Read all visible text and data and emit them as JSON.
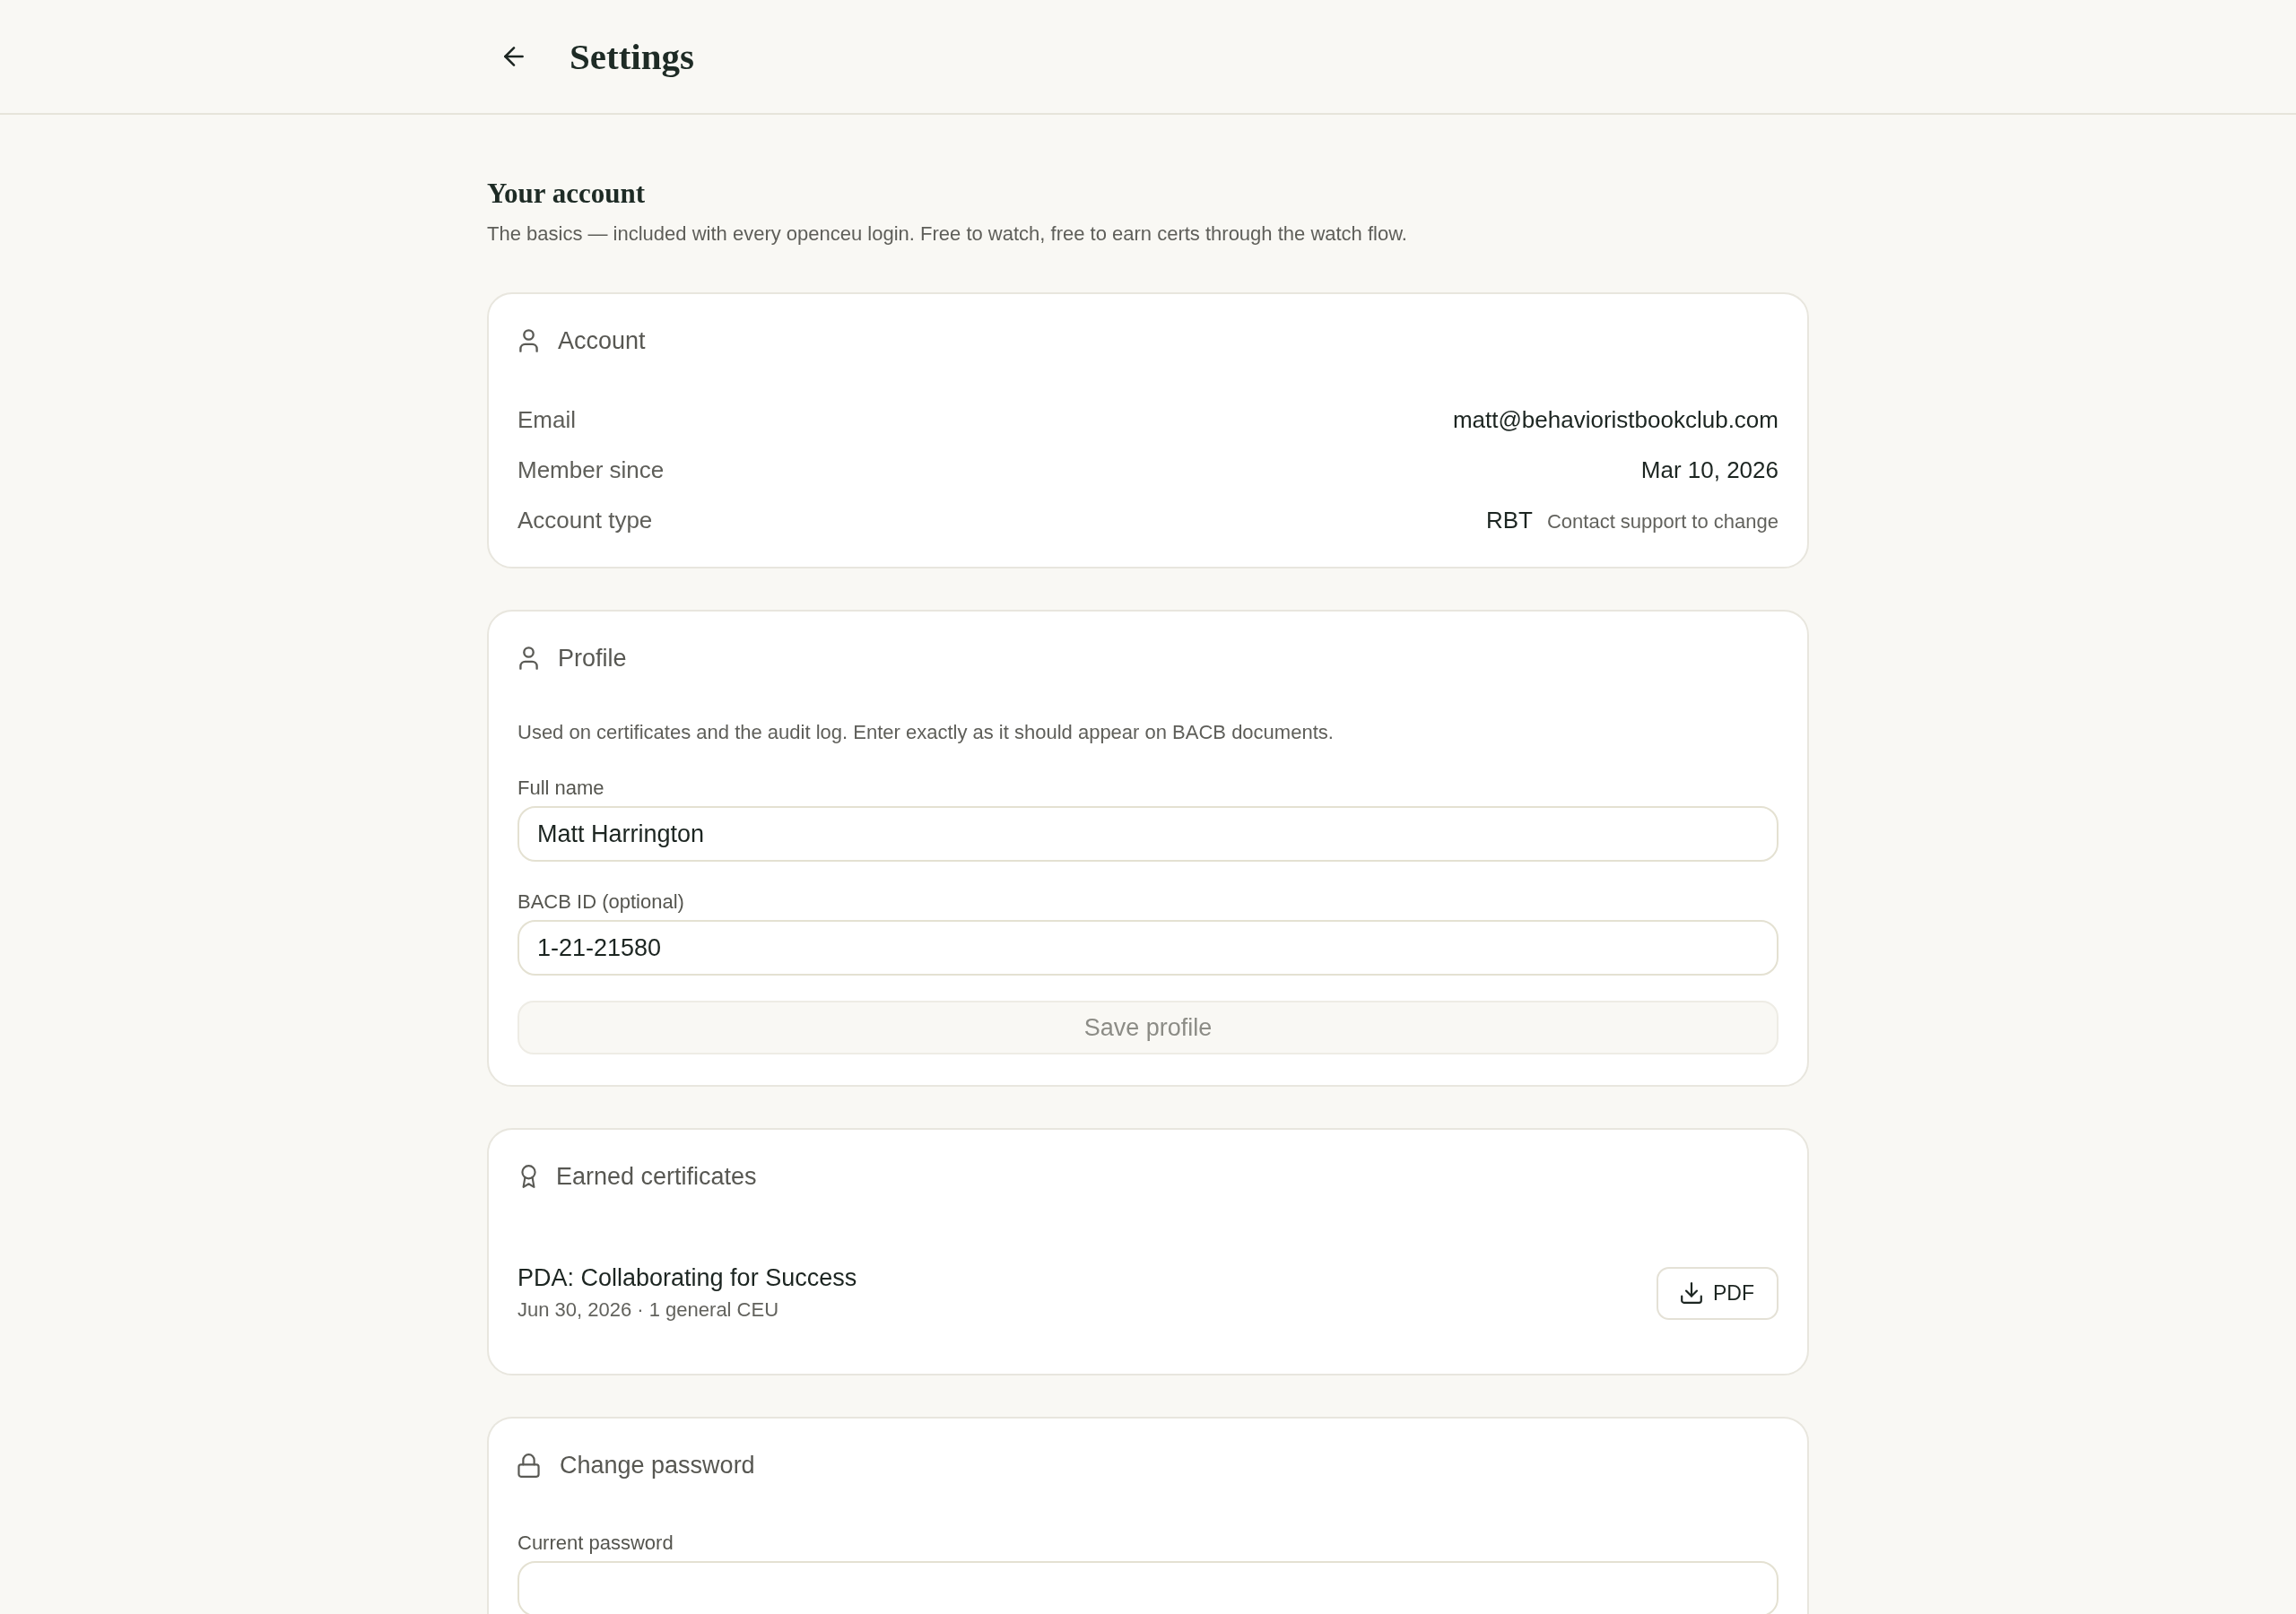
{
  "header": {
    "title": "Settings"
  },
  "intro": {
    "title": "Your account",
    "description": "The basics — included with every openceu login. Free to watch, free to earn certs through the watch flow."
  },
  "account": {
    "title": "Account",
    "rows": [
      {
        "label": "Email",
        "value": "matt@behavioristbookclub.com"
      },
      {
        "label": "Member since",
        "value": "Mar 10, 2026"
      },
      {
        "label": "Account type",
        "value": "RBT",
        "note": "Contact support to change"
      }
    ]
  },
  "profile": {
    "title": "Profile",
    "description": "Used on certificates and the audit log. Enter exactly as it should appear on BACB documents.",
    "fields": [
      {
        "label": "Full name",
        "value": "Matt Harrington"
      },
      {
        "label": "BACB ID (optional)",
        "value": "1-21-21580"
      }
    ],
    "save_button": {
      "label": "Save profile",
      "disabled": true
    }
  },
  "certificates": {
    "title": "Earned certificates",
    "items": [
      {
        "title": "PDA: Collaborating for Success",
        "details": "Jun 30, 2026 · 1 general CEU",
        "button": "PDF"
      }
    ]
  },
  "change_password": {
    "title": "Change password",
    "fields": [
      {
        "label": "Current password"
      }
    ]
  }
}
